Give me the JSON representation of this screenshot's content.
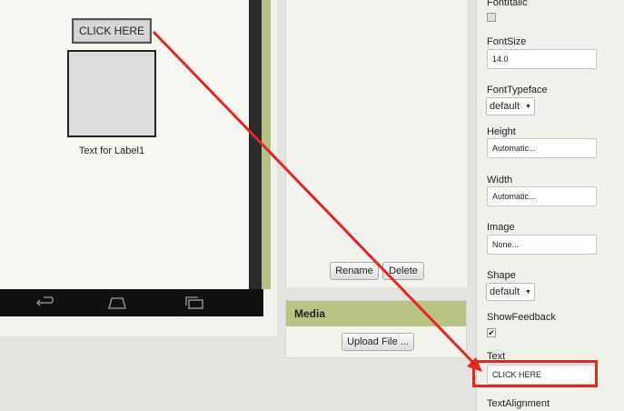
{
  "viewer": {
    "button_text": "CLICK HERE",
    "label_text": "Text for Label1"
  },
  "components": {
    "rename_label": "Rename",
    "delete_label": "Delete"
  },
  "media": {
    "title": "Media",
    "upload_label": "Upload File ..."
  },
  "properties": {
    "font_italic_label": "FontItalic",
    "font_italic_checked": false,
    "font_size_label": "FontSize",
    "font_size_value": "14.0",
    "font_typeface_label": "FontTypeface",
    "font_typeface_value": "default",
    "height_label": "Height",
    "height_value": "Automatic...",
    "width_label": "Width",
    "width_value": "Automatic...",
    "image_label": "Image",
    "image_value": "None...",
    "shape_label": "Shape",
    "shape_value": "default",
    "show_feedback_label": "ShowFeedback",
    "show_feedback_checked": true,
    "text_label": "Text",
    "text_value": "CLICK HERE",
    "text_alignment_label": "TextAlignment"
  },
  "annotation": {
    "color": "#e8241f"
  }
}
